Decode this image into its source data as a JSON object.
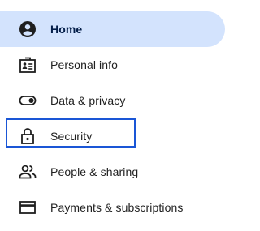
{
  "nav": {
    "items": [
      {
        "label": "Home",
        "icon": "account-circle-icon",
        "active": true
      },
      {
        "label": "Personal info",
        "icon": "id-card-icon",
        "active": false
      },
      {
        "label": "Data & privacy",
        "icon": "toggle-icon",
        "active": false
      },
      {
        "label": "Security",
        "icon": "lock-icon",
        "active": false,
        "focused": true
      },
      {
        "label": "People & sharing",
        "icon": "people-icon",
        "active": false
      },
      {
        "label": "Payments & subscriptions",
        "icon": "credit-card-icon",
        "active": false
      }
    ]
  },
  "colors": {
    "active_background": "#d3e3fd",
    "active_text": "#041e49",
    "focus_ring": "#1a56d6",
    "text": "#1f1f1f"
  }
}
